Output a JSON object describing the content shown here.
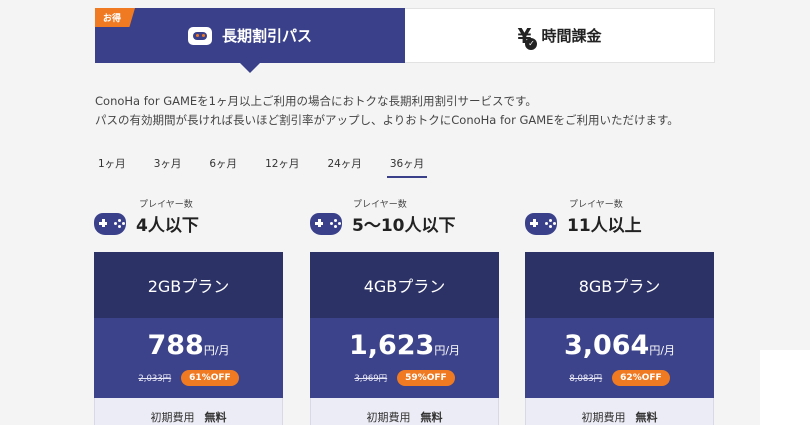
{
  "tabs": {
    "badge": "お得",
    "active_label": "長期割引パス",
    "inactive_label": "時間課金",
    "active_icon": "gamepad-icon",
    "inactive_icon": "yen-icon"
  },
  "description": {
    "line1": "ConoHa for GAMEを1ヶ月以上ご利用の場合におトクな長期利用割引サービスです。",
    "line2": "パスの有効期間が長ければ長いほど割引率がアップし、よりおトクにConoHa for GAMEをご利用いただけます。"
  },
  "periods": [
    "1ヶ月",
    "3ヶ月",
    "6ヶ月",
    "12ヶ月",
    "24ヶ月",
    "36ヶ月"
  ],
  "active_period": "36ヶ月",
  "plans": [
    {
      "players_label": "プレイヤー数",
      "players": "4人以下",
      "name": "2GBプラン",
      "price": "788",
      "unit": "円/月",
      "original": "2,033円",
      "off": "61%OFF",
      "fee_label": "初期費用",
      "fee_value": "無料"
    },
    {
      "players_label": "プレイヤー数",
      "players": "5〜10人以下",
      "name": "4GBプラン",
      "price": "1,623",
      "unit": "円/月",
      "original": "3,969円",
      "off": "59%OFF",
      "fee_label": "初期費用",
      "fee_value": "無料"
    },
    {
      "players_label": "プレイヤー数",
      "players": "11人以上",
      "name": "8GBプラン",
      "price": "3,064",
      "unit": "円/月",
      "original": "8,083円",
      "off": "62%OFF",
      "fee_label": "初期費用",
      "fee_value": "無料"
    }
  ],
  "colors": {
    "primary": "#3a418a",
    "primary_dark": "#2c3266",
    "accent": "#f07a22"
  }
}
